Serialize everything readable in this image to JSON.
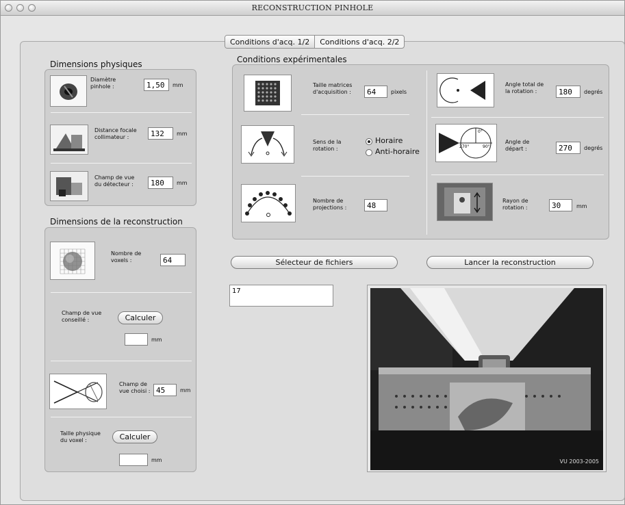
{
  "window": {
    "title": "RECONSTRUCTION PINHOLE"
  },
  "tabs": [
    "Conditions d'acq. 1/2",
    "Conditions d'acq. 2/2"
  ],
  "phys": {
    "title": "Dimensions physiques",
    "pinhole_label": "Diamètre\npinhole :",
    "pinhole_value": "1,50",
    "pinhole_unit": "mm",
    "focal_label": "Distance focale\ncollimateur :",
    "focal_value": "132",
    "focal_unit": "mm",
    "fov_label": "Champ de vue\ndu détecteur :",
    "fov_value": "180",
    "fov_unit": "mm"
  },
  "recon": {
    "title": "Dimensions de la reconstruction",
    "voxels_label": "Nombre de\nvoxels :",
    "voxels_value": "64",
    "advised_label": "Champ de vue\nconseillé :",
    "calc1": "Calculer",
    "advised_unit": "mm",
    "chosen_label": "Champ de\nvue choisi :",
    "chosen_value": "45",
    "chosen_unit": "mm",
    "voxel_size_label": "Taille physique\ndu voxel :",
    "calc2": "Calculer",
    "voxel_size_unit": "mm"
  },
  "exp": {
    "title": "Conditions expérimentales",
    "matrix_label": "Taille matrices\nd'acquisition :",
    "matrix_value": "64",
    "matrix_unit": "pixels",
    "rotation_label": "Sens de la\nrotation :",
    "rot_opt1": "Horaire",
    "rot_opt2": "Anti-horaire",
    "proj_label": "Nombre de\nprojections :",
    "proj_value": "48",
    "angle_total_label": "Angle total de\nla rotation :",
    "angle_total_value": "180",
    "angle_total_unit": "degrés",
    "angle_start_label": "Angle de\ndépart :",
    "angle_start_value": "270",
    "angle_start_unit": "degrés",
    "radius_label": "Rayon de\nrotation :",
    "radius_value": "30",
    "radius_unit": "mm",
    "diagram_deg0": "0°",
    "diagram_deg270": "270°",
    "diagram_deg90": "90°"
  },
  "actions": {
    "file_selector": "Sélecteur de fichiers",
    "launch": "Lancer la reconstruction"
  },
  "output_text": "17",
  "photo_caption": "VU 2003-2005"
}
